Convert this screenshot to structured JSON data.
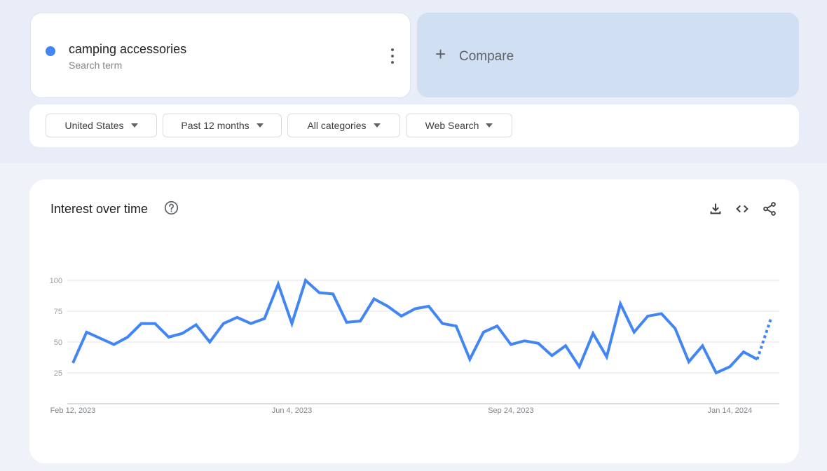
{
  "search_term": {
    "name": "camping accessories",
    "type_label": "Search term",
    "color": "#4285f4"
  },
  "compare": {
    "icon": "plus-icon",
    "label": "Compare"
  },
  "filters": [
    {
      "label": "United States"
    },
    {
      "label": "Past 12 months"
    },
    {
      "label": "All categories"
    },
    {
      "label": "Web Search"
    }
  ],
  "panel": {
    "title": "Interest over time",
    "icons": [
      "help-icon",
      "download-icon",
      "embed-code-icon",
      "share-icon"
    ]
  },
  "chart_data": {
    "type": "line",
    "title": "Interest over time",
    "xlabel": "",
    "ylabel": "",
    "ylim": [
      0,
      100
    ],
    "yticks": [
      25,
      50,
      75,
      100
    ],
    "xtick_labels": [
      {
        "label": "Feb 12, 2023",
        "index": 0
      },
      {
        "label": "Jun 4, 2023",
        "index": 16
      },
      {
        "label": "Sep 24, 2023",
        "index": 32
      },
      {
        "label": "Jan 14, 2024",
        "index": 48
      }
    ],
    "grid": true,
    "series": [
      {
        "name": "camping accessories",
        "color": "#4285f4",
        "values": [
          33,
          58,
          53,
          48,
          54,
          65,
          65,
          54,
          57,
          64,
          50,
          65,
          70,
          65,
          69,
          97,
          65,
          100,
          90,
          89,
          66,
          67,
          85,
          79,
          71,
          77,
          79,
          65,
          63,
          36,
          58,
          63,
          48,
          51,
          49,
          39,
          47,
          30,
          57,
          38,
          81,
          58,
          71,
          73,
          61,
          34,
          47,
          25,
          30,
          42,
          36,
          69
        ],
        "partial_from_index": 50
      }
    ]
  }
}
